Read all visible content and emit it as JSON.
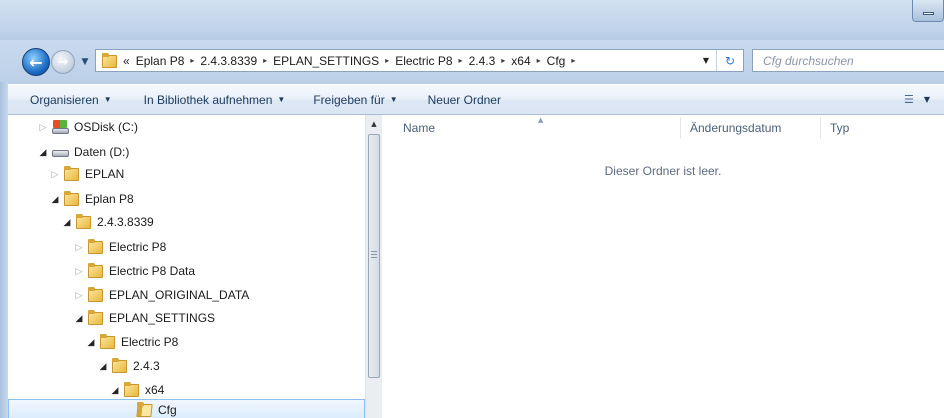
{
  "address": {
    "overflow": "«",
    "crumbs": [
      "Eplan P8",
      "2.4.3.8339",
      "EPLAN_SETTINGS",
      "Electric P8",
      "2.4.3",
      "x64",
      "Cfg"
    ],
    "separator": "▸"
  },
  "search": {
    "placeholder": "Cfg durchsuchen"
  },
  "toolbar": {
    "organize": "Organisieren",
    "library": "In Bibliothek aufnehmen",
    "share": "Freigeben für",
    "new_folder": "Neuer Ordner"
  },
  "tree": [
    {
      "label": "OSDisk (C:)",
      "icon": "system-drive-icon",
      "state": "collapsed"
    },
    {
      "label": "Daten (D:)",
      "icon": "data-drive-icon",
      "state": "expanded"
    },
    {
      "label": "EPLAN",
      "icon": "folder-icon",
      "state": "collapsed"
    },
    {
      "label": "Eplan P8",
      "icon": "folder-icon",
      "state": "expanded"
    },
    {
      "label": "2.4.3.8339",
      "icon": "folder-icon",
      "state": "expanded"
    },
    {
      "label": "Electric P8",
      "icon": "folder-icon",
      "state": "collapsed"
    },
    {
      "label": "Electric P8 Data",
      "icon": "folder-icon",
      "state": "collapsed"
    },
    {
      "label": "EPLAN_ORIGINAL_DATA",
      "icon": "folder-icon",
      "state": "collapsed"
    },
    {
      "label": "EPLAN_SETTINGS",
      "icon": "folder-icon",
      "state": "expanded"
    },
    {
      "label": "Electric P8",
      "icon": "folder-icon",
      "state": "expanded"
    },
    {
      "label": "2.4.3",
      "icon": "folder-icon",
      "state": "expanded"
    },
    {
      "label": "x64",
      "icon": "folder-icon",
      "state": "expanded"
    },
    {
      "label": "Cfg",
      "icon": "open-folder-icon",
      "state": "selected"
    }
  ],
  "columns": {
    "name": "Name",
    "date": "Änderungsdatum",
    "type": "Typ"
  },
  "empty_message": "Dieser Ordner ist leer.",
  "colors": {
    "accent": "#1e6fc6",
    "selection": "#d9ebfb",
    "chrome": "#b9cde5"
  }
}
